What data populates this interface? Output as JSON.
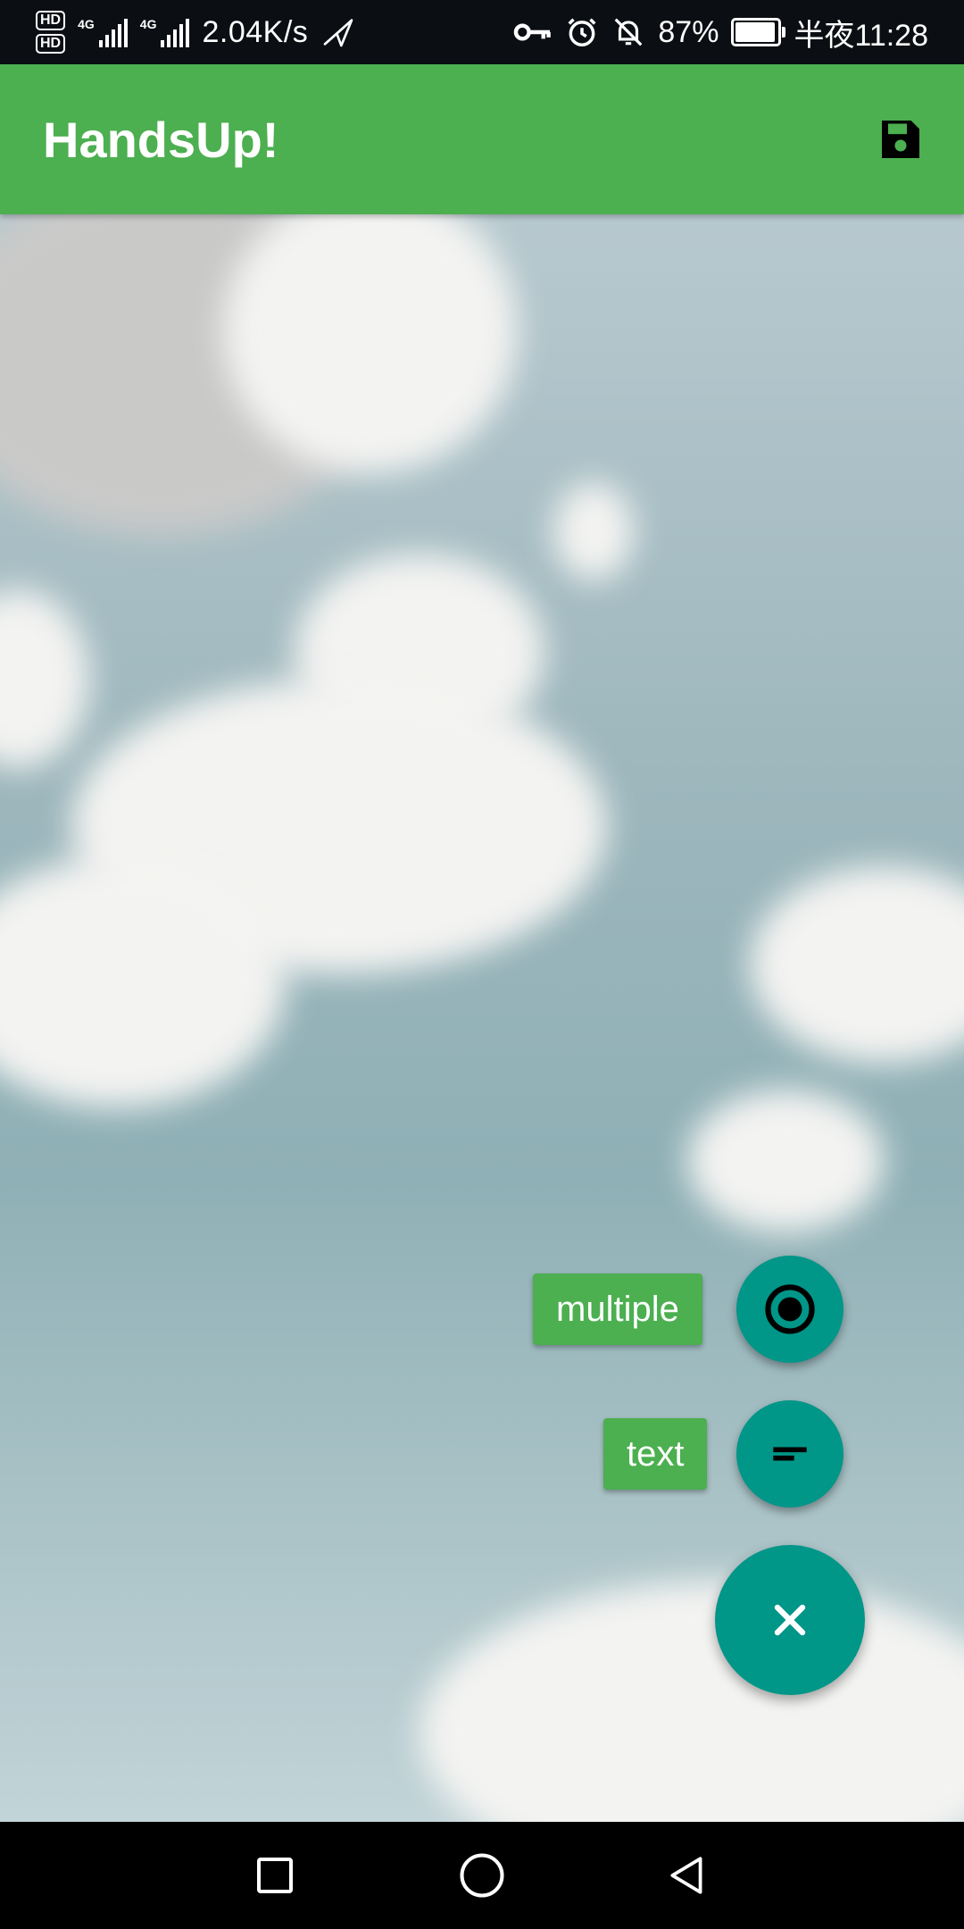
{
  "status_bar": {
    "hd1": "HD",
    "hd2": "HD",
    "sim1_label": "4G",
    "sim2_label": "4G",
    "net_speed": "2.04K/s",
    "battery_percent": "87%",
    "battery_level": 0.87,
    "time": "半夜11:28",
    "icons": [
      "key-icon",
      "alarm-icon",
      "bell-off-icon",
      "send-icon",
      "battery-icon"
    ]
  },
  "app_bar": {
    "title": "HandsUp!",
    "save_icon": "save-icon"
  },
  "fab_menu": {
    "items": [
      {
        "label": "multiple",
        "icon": "radio-checked-icon"
      },
      {
        "label": "text",
        "icon": "short-text-icon"
      }
    ],
    "main_icon": "close-icon"
  },
  "colors": {
    "app_bar": "#4caf50",
    "fab": "#009688",
    "label_bg": "#4caf50"
  },
  "nav_bar": {
    "icons": [
      "recent-apps-icon",
      "home-icon",
      "back-icon"
    ]
  }
}
